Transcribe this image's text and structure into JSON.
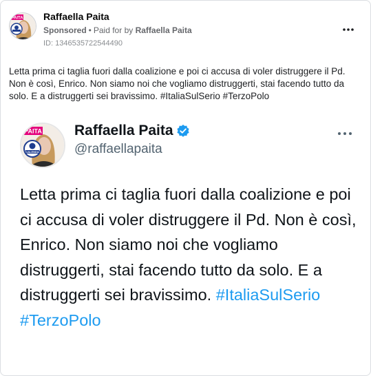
{
  "post": {
    "page_name": "Raffaella Paita",
    "sponsored_label": "Sponsored",
    "separator": "•",
    "paid_for_prefix": "Paid for by",
    "paid_for_by": "Raffaella Paita",
    "ad_id": "ID: 1346535722544490",
    "caption": "Letta prima ci taglia fuori dalla coalizione e poi ci accusa di voler distruggere il Pd. Non è così, Enrico. Non siamo noi che vogliamo distruggerti, stai facendo tutto da solo. E a distruggerti sei bravissimo. #ItaliaSulSerio #TerzoPolo",
    "more_icon": "more-horizontal-icon"
  },
  "avatar": {
    "banner_text": "PAITA",
    "logo_text": "CALENDA",
    "colors": {
      "banner": "#e4007c",
      "logo_ring": "#1e3d8f",
      "skin": "#e9c8b3",
      "hair": "#c79a5d"
    }
  },
  "tweet": {
    "name": "Raffaella Paita",
    "handle": "@raffaellapaita",
    "verified_icon": "verified-badge-icon",
    "more_icon": "more-horizontal-icon",
    "text": "Letta prima ci taglia fuori dalla coalizione e poi ci accusa di voler distruggere il Pd. Non è così, Enrico. Non siamo noi che vogliamo distruggerti, stai facendo tutto da solo. E a distruggerti sei bravissimo.",
    "hashtags": "#ItaliaSulSerio #TerzoPolo",
    "colors": {
      "hashtag": "#1d9bf0",
      "verified": "#1d9bf0"
    }
  }
}
